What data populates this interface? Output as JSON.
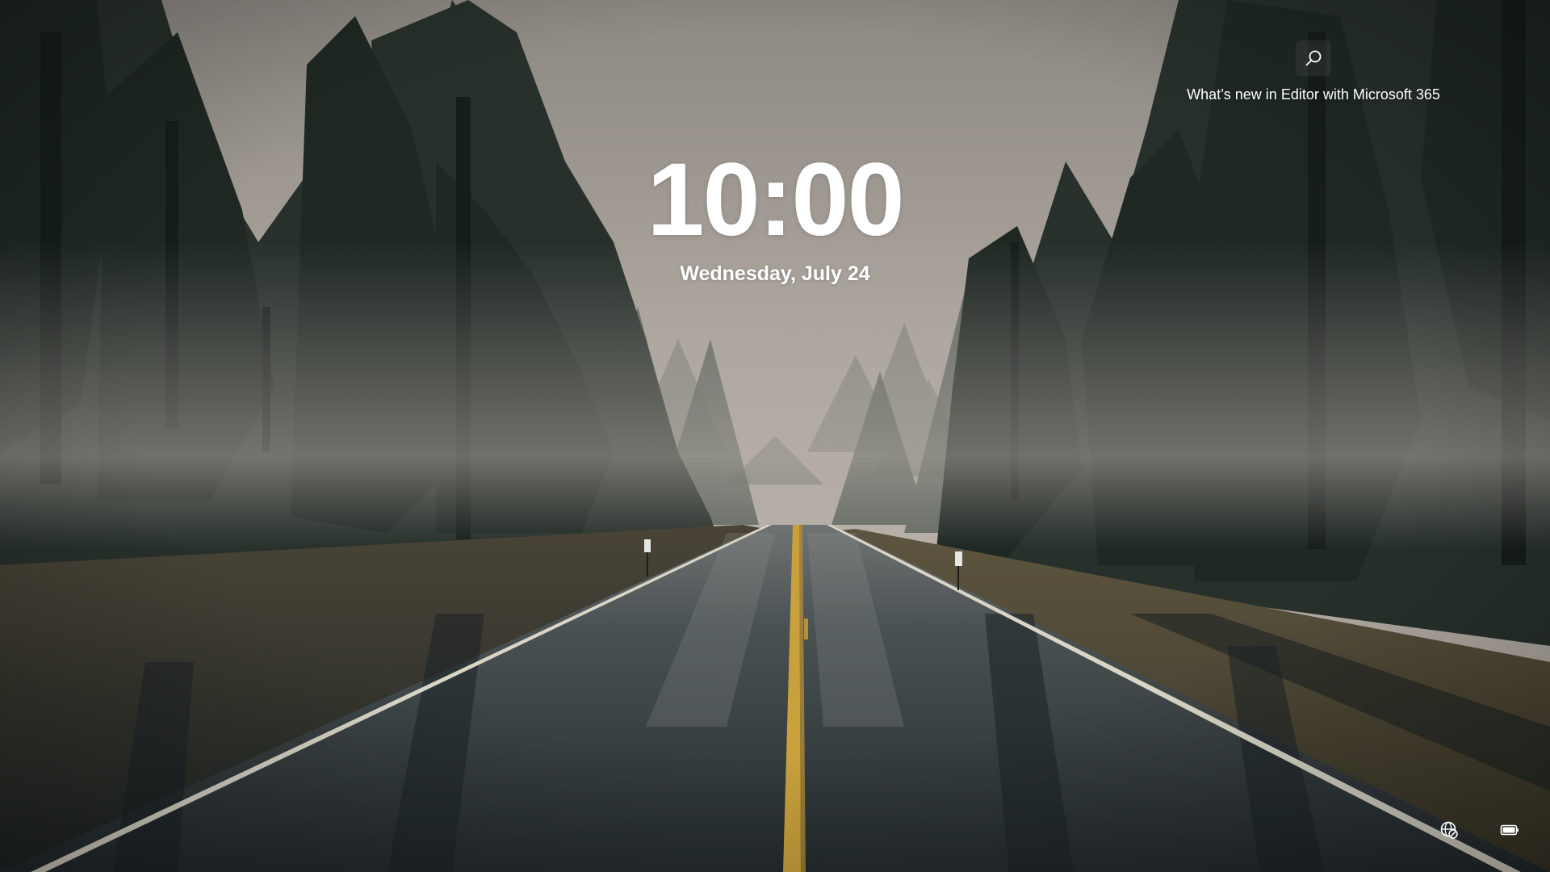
{
  "lockscreen": {
    "time": "10:00",
    "date": "Wednesday, July 24"
  },
  "spotlight": {
    "icon": "search-icon",
    "title": "What’s new in Editor with Microsoft 365"
  },
  "tray": {
    "network_icon": "network-disconnected-icon",
    "battery_icon": "battery-icon"
  },
  "colors": {
    "sky": "#a39d97",
    "trees": "#232d27",
    "road": "#2d3437",
    "centerline": "#c9a13c",
    "text": "#ffffff"
  }
}
